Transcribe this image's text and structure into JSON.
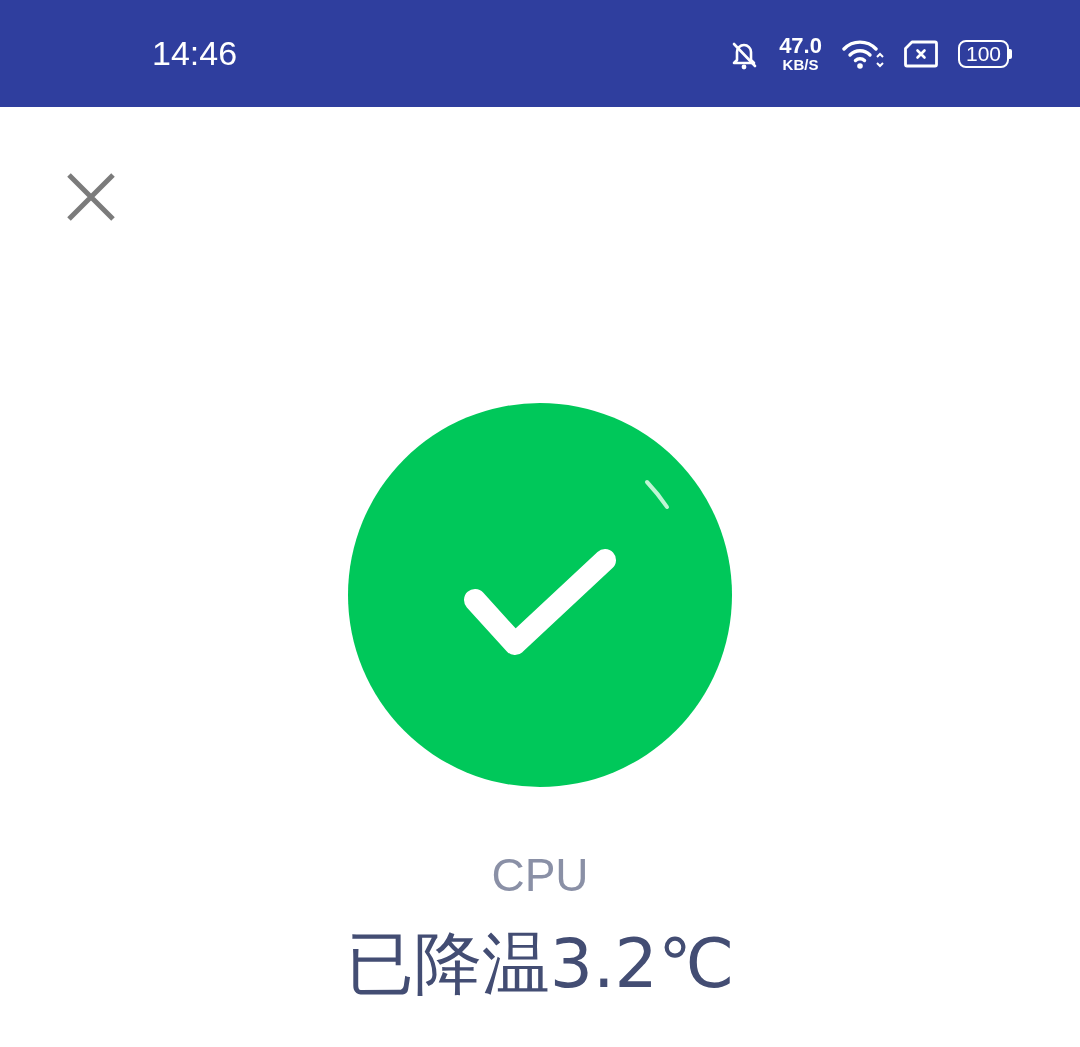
{
  "status_bar": {
    "time": "14:46",
    "speed_value": "47.0",
    "speed_unit": "KB/S",
    "battery": "100"
  },
  "result": {
    "label": "CPU",
    "message": "已降温3.2℃"
  }
}
